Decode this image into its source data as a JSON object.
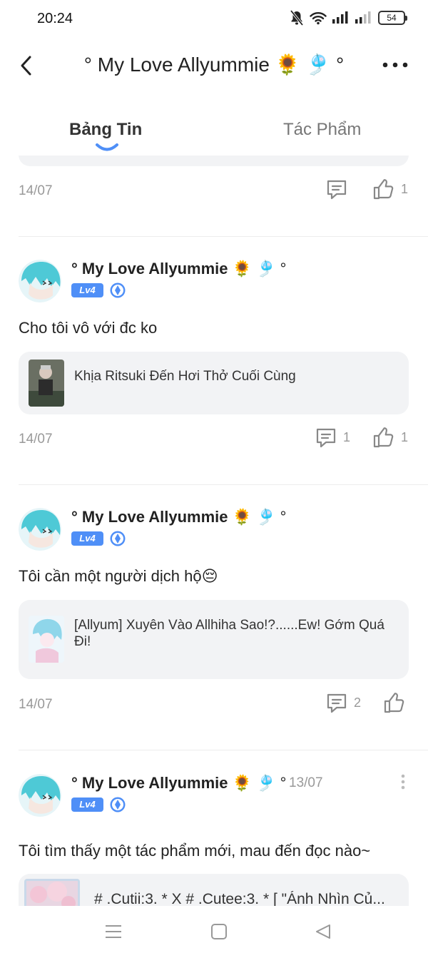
{
  "status_bar": {
    "time": "20:24",
    "battery": "54"
  },
  "header": {
    "title": "° My Love Allyummie 🌻 🎐 °"
  },
  "tabs": [
    {
      "label": "Bảng Tin"
    },
    {
      "label": "Tác Phẩm"
    }
  ],
  "posts": [
    {
      "date": "14/07",
      "like_count": "1"
    },
    {
      "author": "° My Love Allyummie",
      "author_suffix": " 🌻 🎐 °",
      "level": "Lv4",
      "text": "Cho tôi vô với đc ko",
      "link_title": "Khịa Ritsuki Đến Hơi Thở Cuối Cùng",
      "date": "14/07",
      "comment_count": "1",
      "like_count": "1"
    },
    {
      "author": "° My Love Allyummie",
      "author_suffix": " 🌻 🎐 °",
      "level": "Lv4",
      "text": "Tôi cần một người dịch hộ😔",
      "link_title": "[Allyum] Xuyên Vào Allhiha Sao!?......Ew! Gớm Quá Đi!",
      "date": "14/07",
      "comment_count": "2"
    },
    {
      "author": "° My Love Allyummie",
      "author_suffix": " 🌻 🎐 °",
      "time": "13/07",
      "level": "Lv4",
      "text": "Tôi tìm thấy một tác phẩm mới, mau đến đọc nào~",
      "link_title": "# .Cutii:3. * X # .Cutee:3. * [ \"Ánh Nhìn Củ..."
    }
  ],
  "colors": {
    "accent": "#4f8ff7",
    "card_bg": "#f2f3f5",
    "muted": "#999999"
  }
}
